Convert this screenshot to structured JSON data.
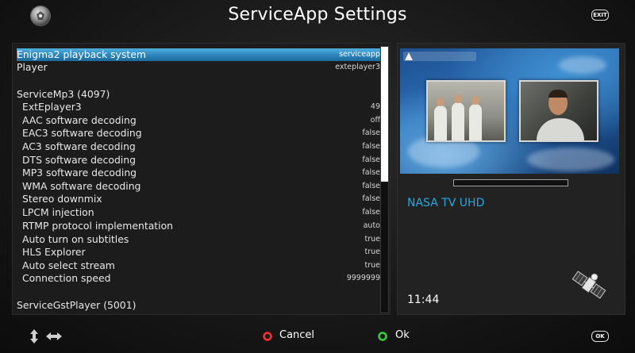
{
  "header": {
    "title": "ServiceApp Settings",
    "exit_key": "EXIT"
  },
  "settings": [
    {
      "label": "Enigma2 playback system",
      "value": "serviceapp",
      "selected": true,
      "indent": false
    },
    {
      "label": "Player",
      "value": "exteplayer3",
      "indent": false
    },
    {
      "label": "ServiceMp3 (4097)",
      "value": "",
      "indent": false
    },
    {
      "label": "ExtEplayer3",
      "value": "49",
      "indent": true
    },
    {
      "label": "AAC software decoding",
      "value": "off",
      "indent": true
    },
    {
      "label": "EAC3 software decoding",
      "value": "false",
      "indent": true
    },
    {
      "label": "AC3 software decoding",
      "value": "false",
      "indent": true
    },
    {
      "label": "DTS software decoding",
      "value": "false",
      "indent": true
    },
    {
      "label": "MP3 software decoding",
      "value": "false",
      "indent": true
    },
    {
      "label": "WMA software decoding",
      "value": "false",
      "indent": true
    },
    {
      "label": "Stereo downmix",
      "value": "false",
      "indent": true
    },
    {
      "label": "LPCM injection",
      "value": "false",
      "indent": true
    },
    {
      "label": "RTMP protocol implementation",
      "value": "auto",
      "indent": true
    },
    {
      "label": "Auto turn on subtitles",
      "value": "true",
      "indent": true
    },
    {
      "label": "HLS Explorer",
      "value": "true",
      "indent": true
    },
    {
      "label": "Auto select stream",
      "value": "true",
      "indent": true
    },
    {
      "label": "Connection speed",
      "value": "9999999",
      "indent": true
    },
    {
      "label": "ServiceGstPlayer (5001)",
      "value": "",
      "indent": false
    }
  ],
  "info": {
    "channel_name": "NASA TV UHD",
    "clock": "11:44"
  },
  "footer": {
    "cancel_label": "Cancel",
    "ok_label": "Ok",
    "ok_key": "OK"
  },
  "colors": {
    "selection": "#2f88bd",
    "channel_text": "#27a8e0",
    "red_button": "#ff3a3a",
    "green_button": "#40d040"
  }
}
